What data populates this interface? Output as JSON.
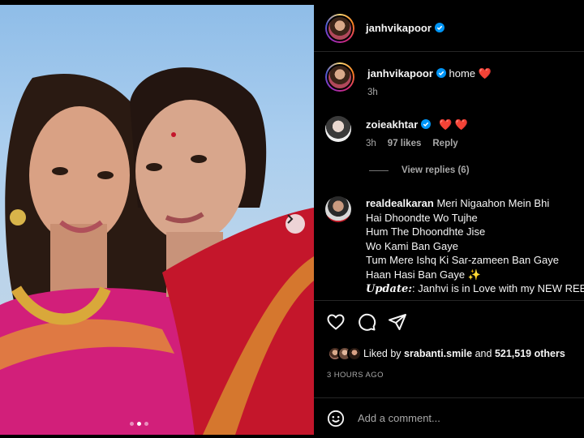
{
  "post": {
    "author": "janhvikapoor",
    "verified": true,
    "carousel": {
      "slides": 3,
      "active_index": 1
    }
  },
  "caption": {
    "user": "janhvikapoor",
    "text": "home",
    "emoji": "❤️",
    "time": "3h"
  },
  "comments": [
    {
      "user": "zoieakhtar",
      "verified": true,
      "text": "❤️ ❤️",
      "time": "3h",
      "likes": "97 likes",
      "reply_label": "Reply",
      "view_replies": "View replies (6)"
    },
    {
      "user": "realdealkaran",
      "text_lines": [
        "Meri Nigaahon Mein Bhi",
        "Hai Dhoondte Wo Tujhe",
        "Hum The Dhoondhte Jise",
        "Wo Kami Ban Gaye",
        "Tum Mere Ishq Ki Sar-zameen Ban Gaye",
        "Haan Hasi Ban Gaye ✨"
      ],
      "update_label": "Update:",
      "update_text": ": Janhvi is in Love with my NEW REEL"
    }
  ],
  "actions": {
    "icons": [
      "heart-icon",
      "comment-icon",
      "share-icon"
    ]
  },
  "likes": {
    "prefix": "Liked by",
    "user": "srabanti.smile",
    "joiner": "and",
    "count": "521,519 others"
  },
  "timestamp": "3 HOURS AGO",
  "add_comment": {
    "placeholder": "Add a comment..."
  },
  "colors": {
    "heart": "#ed4956",
    "verified": "#0095f6",
    "background": "#000000",
    "muted": "#a8a8a8"
  }
}
